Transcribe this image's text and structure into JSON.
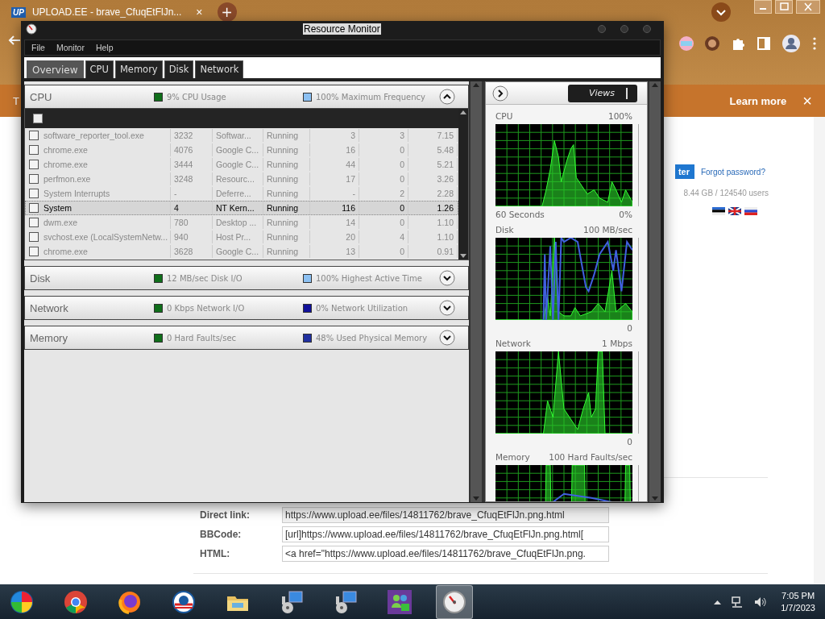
{
  "browser": {
    "tab": {
      "favicon": "UP",
      "title": "UPLOAD.EE - brave_CfuqEtFlJn...",
      "close": "×"
    },
    "new_tab": "+",
    "banner": {
      "text": "T",
      "link": "Learn more",
      "close": "×"
    }
  },
  "page": {
    "login_button": "ter",
    "forgot_link": "Forgot password?",
    "stats": "8.44 GB  /  124540 users",
    "links": [
      {
        "label": "Direct link:",
        "value": "https://www.upload.ee/files/14811762/brave_CfuqEtFlJn.png.html"
      },
      {
        "label": "BBCode:",
        "value": "[url]https://www.upload.ee/files/14811762/brave_CfuqEtFlJn.png.html["
      },
      {
        "label": "HTML:",
        "value": "<a href=\"https://www.upload.ee/files/14811762/brave_CfuqEtFlJn.png."
      }
    ]
  },
  "resource_monitor": {
    "title": "Resource Monitor",
    "menu": [
      "File",
      "Monitor",
      "Help"
    ],
    "tabs": [
      {
        "label": "Overview",
        "selected": true
      },
      {
        "label": "CPU",
        "selected": false
      },
      {
        "label": "Memory",
        "selected": false
      },
      {
        "label": "Disk",
        "selected": false
      },
      {
        "label": "Network",
        "selected": false
      }
    ],
    "sections": [
      {
        "title": "CPU",
        "expanded": true,
        "stats": [
          {
            "text": "9% CPU Usage",
            "color": "#0f6e1a"
          },
          {
            "text": "100% Maximum Frequency",
            "color": "#8cc0f2"
          }
        ]
      },
      {
        "title": "Disk",
        "expanded": false,
        "stats": [
          {
            "text": "12 MB/sec Disk I/O",
            "color": "#0f6e1a"
          },
          {
            "text": "100% Highest Active Time",
            "color": "#8cc0f2"
          }
        ]
      },
      {
        "title": "Network",
        "expanded": false,
        "stats": [
          {
            "text": "0 Kbps Network I/O",
            "color": "#0f6e1a"
          },
          {
            "text": "0% Network Utilization",
            "color": "#10109a"
          }
        ]
      },
      {
        "title": "Memory",
        "expanded": false,
        "stats": [
          {
            "text": "0 Hard Faults/sec",
            "color": "#0f6e1a"
          },
          {
            "text": "48% Used Physical Memory",
            "color": "#2030a0"
          }
        ]
      }
    ],
    "processes": {
      "select_all": {
        "checked": false
      },
      "rows": [
        {
          "checked": false,
          "selected": false,
          "cells": [
            "software_reporter_tool.exe",
            "3232",
            "Softwar...",
            "Running",
            "3",
            "3",
            "7.15"
          ]
        },
        {
          "checked": false,
          "selected": false,
          "cells": [
            "chrome.exe",
            "4076",
            "Google C...",
            "Running",
            "16",
            "0",
            "5.48"
          ]
        },
        {
          "checked": false,
          "selected": false,
          "cells": [
            "chrome.exe",
            "3444",
            "Google C...",
            "Running",
            "44",
            "0",
            "5.21"
          ]
        },
        {
          "checked": false,
          "selected": false,
          "cells": [
            "perfmon.exe",
            "3248",
            "Resourc...",
            "Running",
            "17",
            "0",
            "3.26"
          ]
        },
        {
          "checked": false,
          "selected": false,
          "cells": [
            "System Interrupts",
            "-",
            "Deferre...",
            "Running",
            "-",
            "2",
            "2.28"
          ]
        },
        {
          "checked": false,
          "selected": true,
          "cells": [
            "System",
            "4",
            "NT Kern...",
            "Running",
            "116",
            "0",
            "1.26"
          ]
        },
        {
          "checked": false,
          "selected": false,
          "cells": [
            "dwm.exe",
            "780",
            "Desktop ...",
            "Running",
            "14",
            "0",
            "1.10"
          ]
        },
        {
          "checked": false,
          "selected": false,
          "cells": [
            "svchost.exe (LocalSystemNetw...",
            "940",
            "Host Pr...",
            "Running",
            "20",
            "4",
            "1.10"
          ]
        },
        {
          "checked": false,
          "selected": false,
          "cells": [
            "chrome.exe",
            "3628",
            "Google C...",
            "Running",
            "13",
            "0",
            "0.91"
          ]
        }
      ]
    },
    "views_button": "Views",
    "graphs": [
      {
        "title": "CPU",
        "max": "100%",
        "span": "60 Seconds",
        "min": "0%"
      },
      {
        "title": "Disk",
        "max": "100 MB/sec",
        "min": "0"
      },
      {
        "title": "Network",
        "max": "1 Mbps",
        "min": "0"
      },
      {
        "title": "Memory",
        "max": "100 Hard Faults/sec"
      }
    ]
  },
  "taskbar": {
    "apps": [
      {
        "kind": "start",
        "active": false
      },
      {
        "kind": "chrome",
        "active": false
      },
      {
        "kind": "firefox",
        "active": false
      },
      {
        "kind": "round-logo",
        "active": false
      },
      {
        "kind": "folder",
        "active": false
      },
      {
        "kind": "installer",
        "active": false
      },
      {
        "kind": "installer",
        "active": false
      },
      {
        "kind": "people",
        "active": false
      },
      {
        "kind": "gauge",
        "active": true
      }
    ],
    "clock": {
      "time": "7:05 PM",
      "date": "1/7/2023"
    }
  }
}
